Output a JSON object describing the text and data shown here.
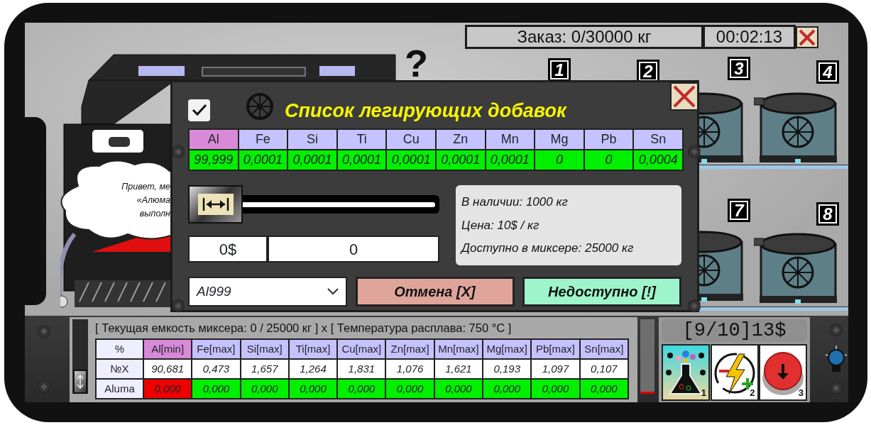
{
  "top_bar": {
    "order": "Заказ: 0/30000 кг",
    "timer": "00:02:13"
  },
  "scene": {
    "hint_mark": "?",
    "speech_bubble": {
      "lines": [
        "Привет, ме",
        "«Алюма",
        "выполн"
      ]
    },
    "furnaces": [
      {
        "number": "1",
        "kind": "hidden"
      },
      {
        "number": "2",
        "kind": "hidden"
      },
      {
        "number": "3",
        "kind": "partial"
      },
      {
        "number": "4",
        "kind": "full"
      },
      {
        "number": "7",
        "kind": "partial"
      },
      {
        "number": "8",
        "kind": "full"
      }
    ]
  },
  "dialog": {
    "title": "Список легирующих добавок",
    "checked": true,
    "elements": [
      {
        "symbol": "Al",
        "value": "99,999",
        "selected": true
      },
      {
        "symbol": "Fe",
        "value": "0,0001",
        "selected": false
      },
      {
        "symbol": "Si",
        "value": "0,0001",
        "selected": false
      },
      {
        "symbol": "Ti",
        "value": "0,0001",
        "selected": false
      },
      {
        "symbol": "Cu",
        "value": "0,0001",
        "selected": false
      },
      {
        "symbol": "Zn",
        "value": "0,0001",
        "selected": false
      },
      {
        "symbol": "Mn",
        "value": "0,0001",
        "selected": false
      },
      {
        "symbol": "Mg",
        "value": "0",
        "selected": false
      },
      {
        "symbol": "Pb",
        "value": "0",
        "selected": false
      },
      {
        "symbol": "Sn",
        "value": "0,0004",
        "selected": false
      }
    ],
    "slider": {
      "level": 0
    },
    "cost": "0$",
    "amount": "0",
    "info": [
      "В наличии: 1000  кг",
      "Цена: 10$ / кг",
      "Доступно в миксере: 25000  кг"
    ],
    "alloy_select": "Al999",
    "buttons": [
      {
        "label": "Отмена [X]",
        "kind": "cancel"
      },
      {
        "label": "Недоступно [!]",
        "kind": "unavailable"
      }
    ]
  },
  "mixer": {
    "status": "[ Текущая емкость миксера: 0 / 25000 кг ] x [ Температура расплава: 750 °C ]",
    "slider": {
      "level": 0
    },
    "corner": "%",
    "columns": [
      {
        "label": "Al[min]",
        "highlight": true
      },
      {
        "label": "Fe[max]",
        "highlight": false
      },
      {
        "label": "Si[max]",
        "highlight": false
      },
      {
        "label": "Ti[max]",
        "highlight": false
      },
      {
        "label": "Cu[max]",
        "highlight": false
      },
      {
        "label": "Zn[max]",
        "highlight": false
      },
      {
        "label": "Mn[max]",
        "highlight": false
      },
      {
        "label": "Mg[max]",
        "highlight": false
      },
      {
        "label": "Pb[max]",
        "highlight": false
      },
      {
        "label": "Sn[max]",
        "highlight": false
      }
    ],
    "rows": [
      {
        "label": "№X",
        "kind": "limits",
        "cells": [
          {
            "value": "90,681"
          },
          {
            "value": "0,473"
          },
          {
            "value": "1,657"
          },
          {
            "value": "1,264"
          },
          {
            "value": "1,831"
          },
          {
            "value": "1,076"
          },
          {
            "value": "1,621"
          },
          {
            "value": "0,193"
          },
          {
            "value": "1,097"
          },
          {
            "value": "0,107"
          }
        ]
      },
      {
        "label": "Aluma",
        "kind": "check",
        "cells": [
          {
            "value": "0,000",
            "ok": false
          },
          {
            "value": "0,000",
            "ok": true
          },
          {
            "value": "0,000",
            "ok": true
          },
          {
            "value": "0,000",
            "ok": true
          },
          {
            "value": "0,000",
            "ok": true
          },
          {
            "value": "0,000",
            "ok": true
          },
          {
            "value": "0,000",
            "ok": true
          },
          {
            "value": "0,000",
            "ok": true
          },
          {
            "value": "0,000",
            "ok": true
          },
          {
            "value": "0,000",
            "ok": true
          }
        ]
      }
    ]
  },
  "wallet": "[9/10]13$",
  "tools": [
    {
      "kind": "flask",
      "hotkey": "1"
    },
    {
      "kind": "energy",
      "hotkey": "2"
    },
    {
      "kind": "push",
      "hotkey": "3"
    }
  ]
}
